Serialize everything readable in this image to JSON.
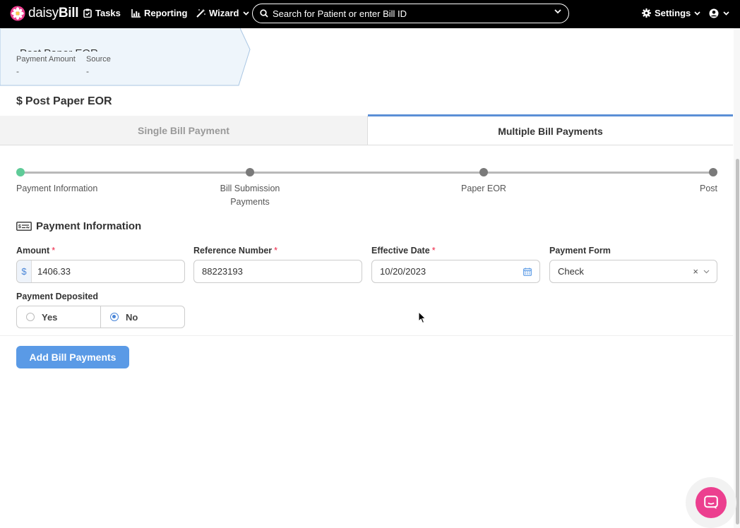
{
  "nav": {
    "logo_light": "daisy",
    "logo_bold": "Bill",
    "tasks": "Tasks",
    "reporting": "Reporting",
    "wizard": "Wizard",
    "search_placeholder": "Search for Patient or enter Bill ID",
    "settings": "Settings"
  },
  "card": {
    "title": "Post Paper EOR",
    "payment_amount_label": "Payment Amount",
    "payment_amount_value": "-",
    "source_label": "Source",
    "source_value": "-"
  },
  "page": {
    "title_icon": "$",
    "title": "Post Paper EOR"
  },
  "tabs": [
    {
      "label": "Single Bill Payment",
      "active": false
    },
    {
      "label": "Multiple Bill Payments",
      "active": true
    }
  ],
  "stepper": {
    "steps": [
      {
        "label": "Payment Information",
        "state": "done"
      },
      {
        "label": "Bill Submission Payments",
        "state": "pending"
      },
      {
        "label": "Paper EOR",
        "state": "pending"
      },
      {
        "label": "Post",
        "state": "pending"
      }
    ]
  },
  "form": {
    "title": "Payment Information",
    "amount": {
      "label": "Amount",
      "required": "*",
      "prefix": "$",
      "value": "1406.33"
    },
    "reference": {
      "label": "Reference Number",
      "required": "*",
      "value": "88223193"
    },
    "effective_date": {
      "label": "Effective Date",
      "required": "*",
      "value": "10/20/2023"
    },
    "payment_form": {
      "label": "Payment Form",
      "value": "Check",
      "clear": "×"
    },
    "deposited": {
      "label": "Payment Deposited",
      "options": [
        "Yes",
        "No"
      ],
      "selected": "No"
    }
  },
  "actions": {
    "add_bill_payments": "Add Bill Payments"
  },
  "colors": {
    "accent": "#5a9ae6",
    "step_done": "#5fcb98",
    "chat": "#ec3f8f"
  }
}
